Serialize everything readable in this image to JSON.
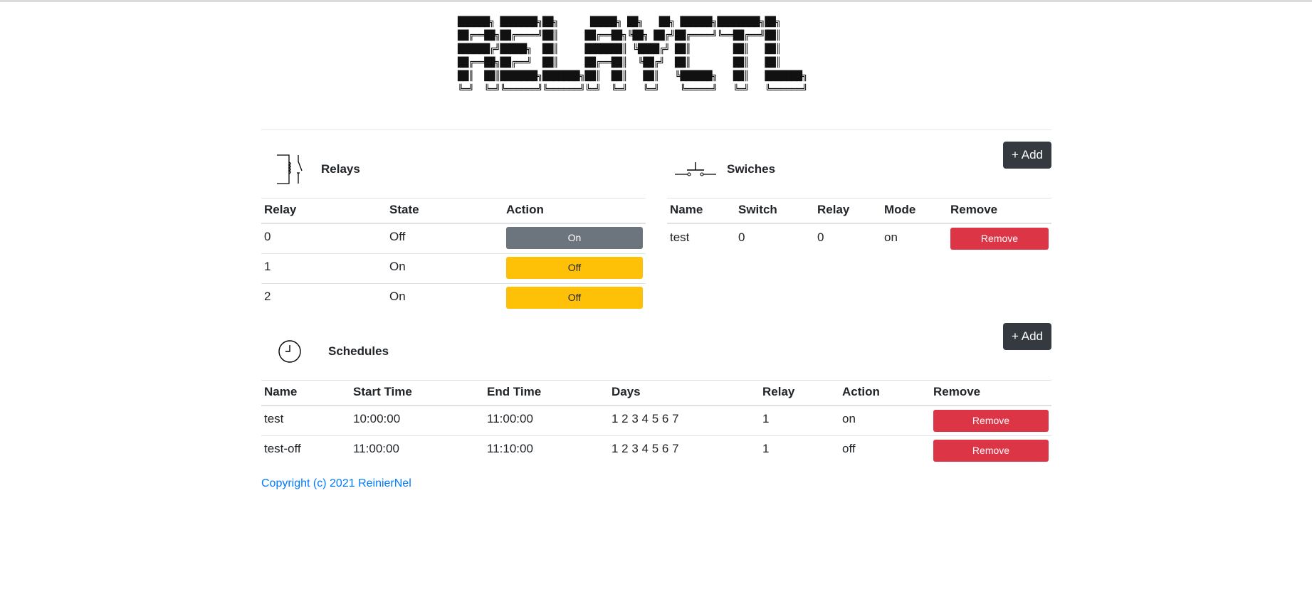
{
  "banner": {
    "lines": [
      "██████╗ ███████╗██╗      █████╗ ██╗   ██╗ ██████╗████████╗██╗",
      "██╔══██╗██╔════╝██║     ██╔══██╗╚██╗ ██╔╝██╔════╝╚══██╔══╝██║",
      "██████╔╝█████╗  ██║     ███████║ ╚████╔╝ ██║        ██║   ██║",
      "██╔══██╗██╔══╝  ██║     ██╔══██║  ╚██╔╝  ██║        ██║   ██║",
      "██║  ██║███████╗███████╗██║  ██║   ██║   ╚██████╗   ██║   ███████╗",
      "╚═╝  ╚═╝╚══════╝╚══════╝╚═╝  ╚═╝   ╚═╝    ╚═════╝   ╚═╝   ╚══════╝"
    ]
  },
  "relays": {
    "title": "Relays",
    "headers": [
      "Relay",
      "State",
      "Action"
    ],
    "rows": [
      {
        "relay": "0",
        "state": "Off",
        "action": "On"
      },
      {
        "relay": "1",
        "state": "On",
        "action": "Off"
      },
      {
        "relay": "2",
        "state": "On",
        "action": "Off"
      }
    ]
  },
  "switches": {
    "title": "Swiches",
    "add_label": "+ Add",
    "headers": [
      "Name",
      "Switch",
      "Relay",
      "Mode",
      "Remove"
    ],
    "rows": [
      {
        "name": "test",
        "switch": "0",
        "relay": "0",
        "mode": "on",
        "remove": "Remove"
      }
    ]
  },
  "schedules": {
    "title": "Schedules",
    "add_label": "+ Add",
    "headers": [
      "Name",
      "Start Time",
      "End Time",
      "Days",
      "Relay",
      "Action",
      "Remove"
    ],
    "rows": [
      {
        "name": "test",
        "start": "10:00:00",
        "end": "11:00:00",
        "days": "1 2 3 4 5 6 7",
        "relay": "1",
        "action": "on",
        "remove": "Remove"
      },
      {
        "name": "test-off",
        "start": "11:00:00",
        "end": "11:10:00",
        "days": "1 2 3 4 5 6 7",
        "relay": "1",
        "action": "off",
        "remove": "Remove"
      }
    ]
  },
  "footer": {
    "copyright": "Copyright (c) 2021 ReinierNel"
  },
  "colors": {
    "secondary": "#6c757d",
    "warning": "#ffc107",
    "danger": "#dc3545",
    "dark": "#343a40",
    "link": "#007bff"
  }
}
